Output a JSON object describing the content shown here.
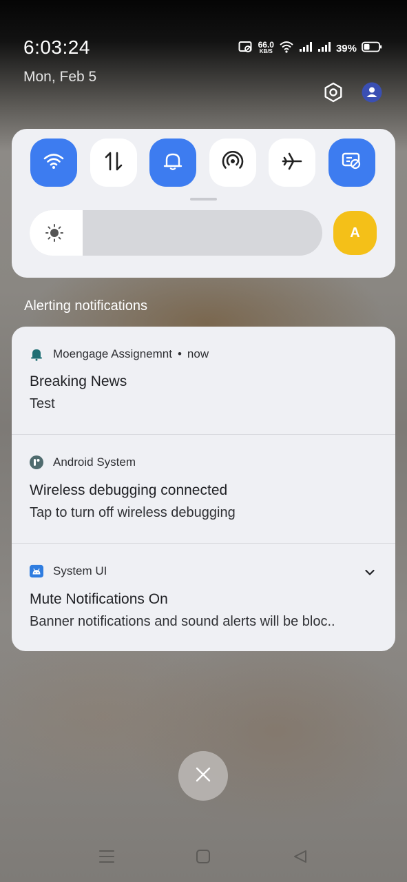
{
  "status_bar": {
    "time": "6:03:24",
    "date": "Mon, Feb 5",
    "net_speed_value": "66.0",
    "net_speed_unit": "KB/S",
    "battery_percent": "39%"
  },
  "quick_settings": {
    "tiles": [
      {
        "name": "wifi",
        "icon": "wifi-icon",
        "active": true
      },
      {
        "name": "mobile-data",
        "icon": "data-arrows-icon",
        "active": false
      },
      {
        "name": "sound",
        "icon": "bell-icon",
        "active": true
      },
      {
        "name": "hotspot",
        "icon": "hotspot-icon",
        "active": false
      },
      {
        "name": "airplane-mode",
        "icon": "airplane-icon",
        "active": false
      },
      {
        "name": "mute-notifications",
        "icon": "mute-notifications-icon",
        "active": true
      }
    ],
    "brightness_level": 0.18,
    "auto_brightness_label": "A"
  },
  "section_title": "Alerting notifications",
  "notifications": [
    {
      "app": "Moengage Assignemnt",
      "time": "now",
      "title": "Breaking News",
      "body": "Test"
    },
    {
      "app": "Android System",
      "title": "Wireless debugging connected",
      "body": "Tap to turn off wireless debugging"
    },
    {
      "app": "System UI",
      "title": "Mute Notifications On",
      "body": "Banner notifications and sound alerts will be bloc.."
    }
  ],
  "colors": {
    "accent": "#3d7cf0",
    "auto_brightness": "#f4c018",
    "panel": "#eff0f4"
  }
}
